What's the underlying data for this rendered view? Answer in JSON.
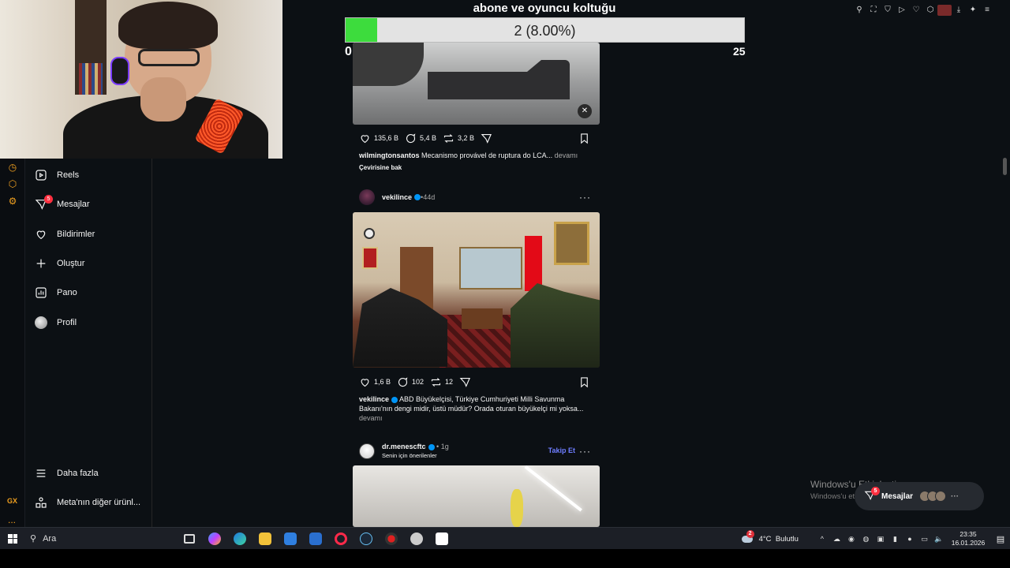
{
  "overlay": {
    "title": "abone ve oyuncu koltuğu",
    "progress_text": "2 (8.00%)",
    "progress_fraction": 0.08,
    "min_label": "0",
    "max_label": "25"
  },
  "sidebar": {
    "items": [
      {
        "label": "Reels",
        "icon": "reels-icon"
      },
      {
        "label": "Mesajlar",
        "icon": "messenger-icon",
        "badge": "5"
      },
      {
        "label": "Bildirimler",
        "icon": "heart-icon"
      },
      {
        "label": "Oluştur",
        "icon": "plus-icon"
      },
      {
        "label": "Pano",
        "icon": "dashboard-icon"
      },
      {
        "label": "Profil",
        "icon": "avatar"
      }
    ],
    "more_label": "Daha fazla",
    "meta_label": "Meta'nın diğer ürünl..."
  },
  "rail": {
    "gx_label": "GX",
    "dots": "..."
  },
  "posts": [
    {
      "likes": "135,6 B",
      "comments": "5,4 B",
      "reposts": "3,2 B",
      "caption_user": "wilmingtonsantos",
      "caption_text": " Mecanismo provável de ruptura do LCA...",
      "more": " devamı",
      "see_translation": "Çevirisine bak"
    },
    {
      "username": "vekilince",
      "dot": " • ",
      "age": "44d",
      "likes": "1,6 B",
      "comments": "102",
      "reposts": "12",
      "caption_user": "vekilince",
      "caption_text": " ABD Büyükelçisi, Türkiye Cumhuriyeti Milli Savunma Bakanı'nın dengi midir, üstü müdür? Orada oturan büyükelçi mi yoksa...",
      "more": "devamı"
    },
    {
      "username": "dr.menescftc",
      "dot": " • ",
      "age": "1g",
      "subtitle": "Senin için önerilenler",
      "follow_label": "Takip Et"
    }
  ],
  "watermark": {
    "title": "Windows'u Etkinleştir",
    "subtitle": "Windows'u etkinleştirmek için Ayarlar'a gidin."
  },
  "messages_pill": {
    "label": "Mesajlar",
    "badge": "5",
    "more": "···"
  },
  "taskbar": {
    "search_placeholder": "Ara",
    "weather_badge": "2",
    "temperature": "4°C",
    "weather_desc": "Bulutlu",
    "time": "23:35",
    "date": "16.01.2026",
    "chevron": "^"
  },
  "colors": {
    "background": "#0c1014",
    "accent_link": "#6e7dff",
    "verified": "#0095f6",
    "badge": "#ff3040",
    "progress_fill": "#3ddc3d"
  }
}
